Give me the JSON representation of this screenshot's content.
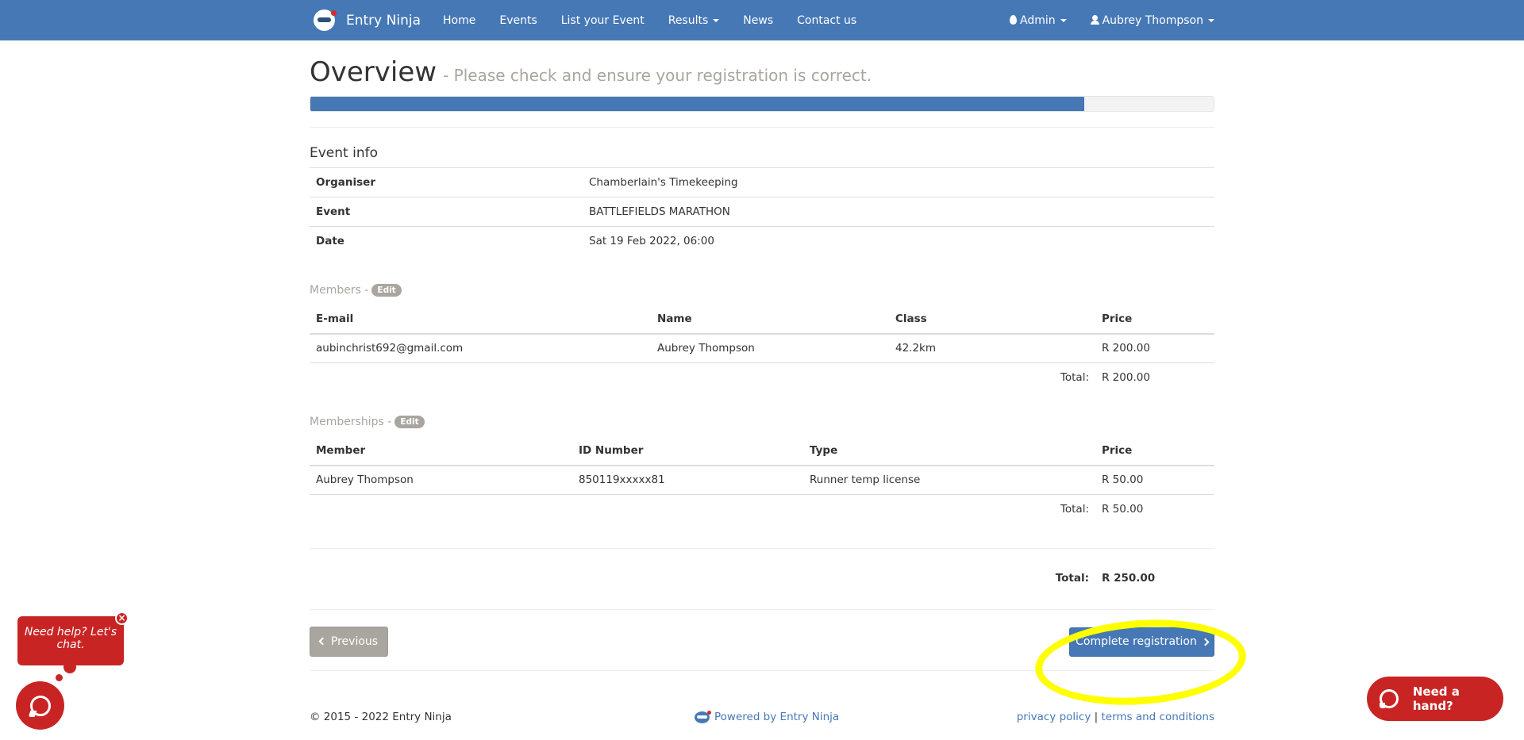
{
  "nav": {
    "brand": "Entry Ninja",
    "links": [
      "Home",
      "Events",
      "List your Event",
      "Results",
      "News",
      "Contact us"
    ],
    "admin": "Admin",
    "user": "Aubrey Thompson"
  },
  "page": {
    "title": "Overview",
    "subtitle": "- Please check and ensure your registration is correct.",
    "progress_fraction": 0.857
  },
  "event_info": {
    "title": "Event info",
    "rows": [
      {
        "label": "Organiser",
        "value": "Chamberlain's Timekeeping"
      },
      {
        "label": "Event",
        "value": "BATTLEFIELDS MARATHON"
      },
      {
        "label": "Date",
        "value": "Sat 19 Feb 2022, 06:00"
      }
    ]
  },
  "members": {
    "title": "Members -",
    "edit": "Edit",
    "headers": [
      "E-mail",
      "Name",
      "Class",
      "Price"
    ],
    "rows": [
      {
        "email": "aubinchrist692@gmail.com",
        "name": "Aubrey Thompson",
        "class": "42.2km",
        "price": "R 200.00"
      }
    ],
    "total_label": "Total:",
    "total": "R 200.00"
  },
  "memberships": {
    "title": "Memberships -",
    "edit": "Edit",
    "headers": [
      "Member",
      "ID Number",
      "Type",
      "Price"
    ],
    "rows": [
      {
        "member": "Aubrey Thompson",
        "id": "850119xxxxx81",
        "type": "Runner temp license",
        "price": "R 50.00"
      }
    ],
    "total_label": "Total:",
    "total": "R 50.00"
  },
  "grand_total": {
    "label": "Total:",
    "value": "R 250.00"
  },
  "buttons": {
    "previous": "Previous",
    "complete": "Complete registration"
  },
  "footer": {
    "copyright": "© 2015 - 2022 Entry Ninja",
    "powered": "Powered by Entry Ninja",
    "privacy": "privacy policy",
    "separator": "|",
    "terms": "terms and conditions"
  },
  "chat": {
    "bubble": "Need help? Let's chat.",
    "close": "×",
    "hand": "Need a hand?"
  },
  "colors": {
    "primary": "#4678b6",
    "chat_red": "#c92424",
    "highlight": "#ffff00",
    "muted": "#a9a59f"
  }
}
